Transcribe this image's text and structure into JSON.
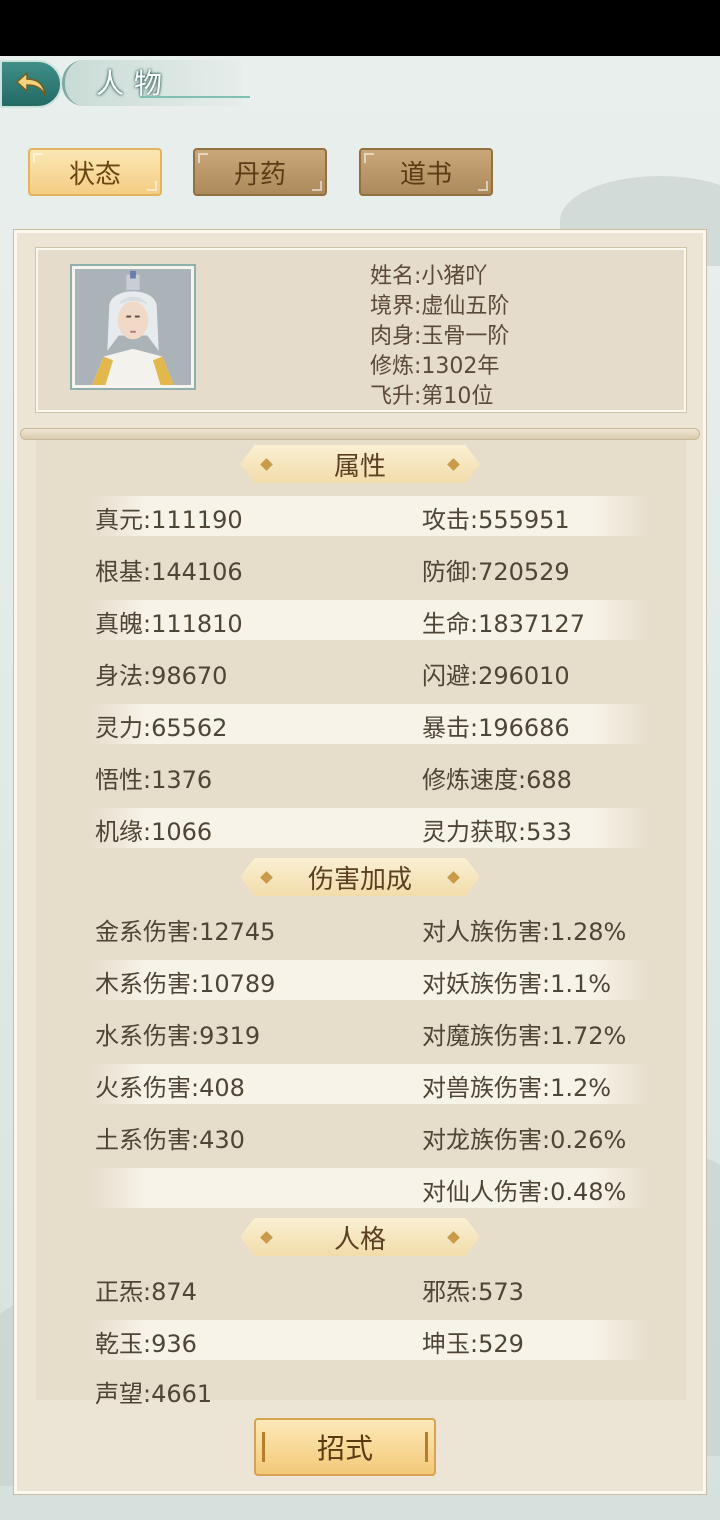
{
  "header": {
    "title": "人物"
  },
  "tabs": [
    {
      "label": "状态",
      "active": true
    },
    {
      "label": "丹药",
      "active": false
    },
    {
      "label": "道书",
      "active": false
    }
  ],
  "profile": {
    "name": "姓名:小猪吖",
    "realm": "境界:虚仙五阶",
    "body": "肉身:玉骨一阶",
    "cultivation": "修炼:1302年",
    "ascension": "飞升:第10位"
  },
  "sections": {
    "attributes": "属性",
    "damage": "伤害加成",
    "personality": "人格"
  },
  "attributes": {
    "left": [
      "真元:111190",
      "根基:144106",
      "真魄:111810",
      "身法:98670",
      "灵力:65562",
      "悟性:1376",
      "机缘:1066"
    ],
    "right": [
      "攻击:555951",
      "防御:720529",
      "生命:1837127",
      "闪避:296010",
      "暴击:196686",
      "修炼速度:688",
      "灵力获取:533"
    ]
  },
  "damage": {
    "left": [
      "金系伤害:12745",
      "木系伤害:10789",
      "水系伤害:9319",
      "火系伤害:408",
      "土系伤害:430"
    ],
    "right": [
      "对人族伤害:1.28%",
      "对妖族伤害:1.1%",
      "对魔族伤害:1.72%",
      "对兽族伤害:1.2%",
      "对龙族伤害:0.26%",
      "对仙人伤害:0.48%"
    ]
  },
  "personality": {
    "left": [
      "正炁:874",
      "乾玉:936",
      "声望:4661"
    ],
    "right": [
      "邪炁:573",
      "坤玉:529"
    ]
  },
  "footer": {
    "skill_label": "招式"
  },
  "colors": {
    "accent": "#f4cd84",
    "back_button": "#2f7d76",
    "panel": "#ece5d6"
  }
}
